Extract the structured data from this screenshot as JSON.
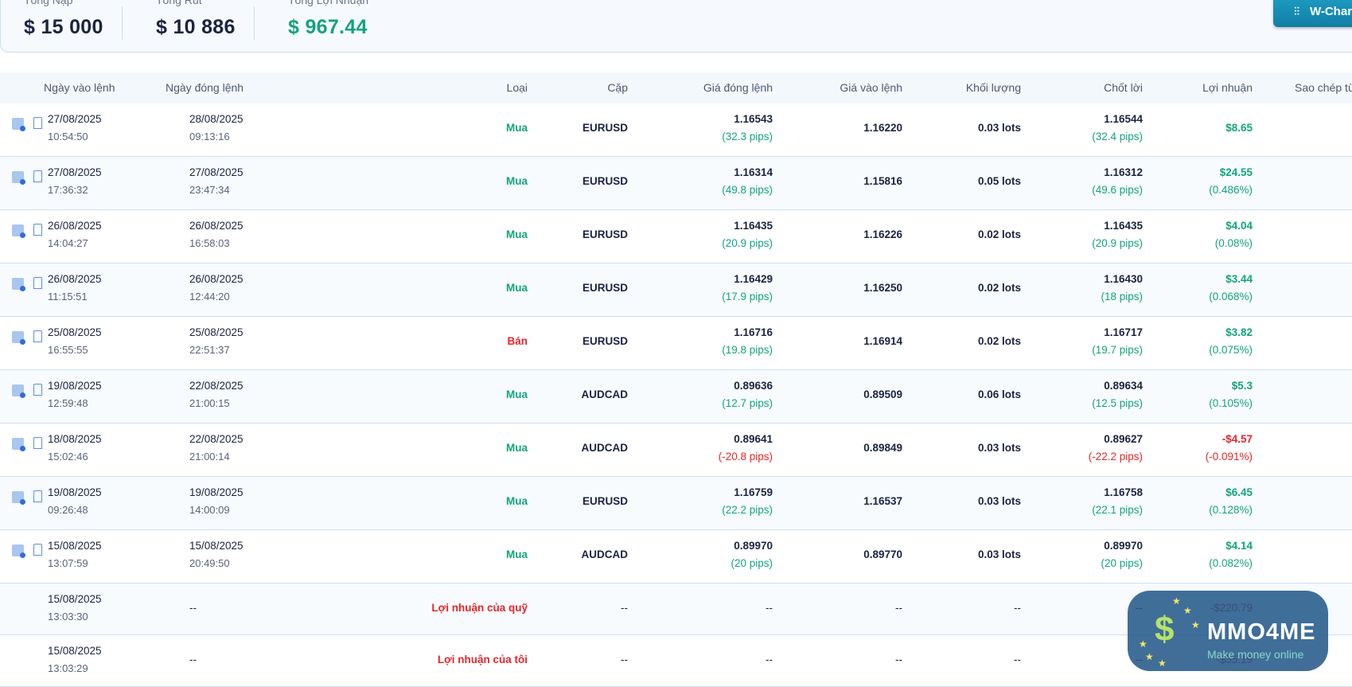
{
  "summary": {
    "deposit_label": "Tổng Nạp",
    "deposit": "$ 15 000",
    "withdraw_label": "Tổng Rút",
    "withdraw": "$ 10 886",
    "profit_label": "Tổng Lợi Nhuận",
    "profit": "$ 967.44"
  },
  "wchart_button": "W-Chart",
  "columns": [
    "Ngày vào lệnh",
    "Ngày đóng lệnh",
    "Loại",
    "Cặp",
    "Giá đóng lệnh",
    "Giá vào lệnh",
    "Khối lượng",
    "Chốt lời",
    "Lợi nhuận",
    "Sao chép từ"
  ],
  "rows": [
    {
      "open_date": "27/08/2025",
      "open_time": "10:54:50",
      "close_date": "28/08/2025",
      "close_time": "09:13:16",
      "type": "Mua",
      "pair": "EURUSD",
      "close_price": "1.16543",
      "close_pips": "(32.3 pips)",
      "open_price": "1.16220",
      "volume": "0.03 lots",
      "tp": "1.16544",
      "tp_pips": "(32.4 pips)",
      "profit": "$8.65",
      "profit_pct": "",
      "neg": false
    },
    {
      "open_date": "27/08/2025",
      "open_time": "17:36:32",
      "close_date": "27/08/2025",
      "close_time": "23:47:34",
      "type": "Mua",
      "pair": "EURUSD",
      "close_price": "1.16314",
      "close_pips": "(49.8 pips)",
      "open_price": "1.15816",
      "volume": "0.05 lots",
      "tp": "1.16312",
      "tp_pips": "(49.6 pips)",
      "profit": "$24.55",
      "profit_pct": "(0.486%)",
      "neg": false
    },
    {
      "open_date": "26/08/2025",
      "open_time": "14:04:27",
      "close_date": "26/08/2025",
      "close_time": "16:58:03",
      "type": "Mua",
      "pair": "EURUSD",
      "close_price": "1.16435",
      "close_pips": "(20.9 pips)",
      "open_price": "1.16226",
      "volume": "0.02 lots",
      "tp": "1.16435",
      "tp_pips": "(20.9 pips)",
      "profit": "$4.04",
      "profit_pct": "(0.08%)",
      "neg": false
    },
    {
      "open_date": "26/08/2025",
      "open_time": "11:15:51",
      "close_date": "26/08/2025",
      "close_time": "12:44:20",
      "type": "Mua",
      "pair": "EURUSD",
      "close_price": "1.16429",
      "close_pips": "(17.9 pips)",
      "open_price": "1.16250",
      "volume": "0.02 lots",
      "tp": "1.16430",
      "tp_pips": "(18 pips)",
      "profit": "$3.44",
      "profit_pct": "(0.068%)",
      "neg": false
    },
    {
      "open_date": "25/08/2025",
      "open_time": "16:55:55",
      "close_date": "25/08/2025",
      "close_time": "22:51:37",
      "type": "Bán",
      "pair": "EURUSD",
      "close_price": "1.16716",
      "close_pips": "(19.8 pips)",
      "open_price": "1.16914",
      "volume": "0.02 lots",
      "tp": "1.16717",
      "tp_pips": "(19.7 pips)",
      "profit": "$3.82",
      "profit_pct": "(0.075%)",
      "neg": false
    },
    {
      "open_date": "19/08/2025",
      "open_time": "12:59:48",
      "close_date": "22/08/2025",
      "close_time": "21:00:15",
      "type": "Mua",
      "pair": "AUDCAD",
      "close_price": "0.89636",
      "close_pips": "(12.7 pips)",
      "open_price": "0.89509",
      "volume": "0.06 lots",
      "tp": "0.89634",
      "tp_pips": "(12.5 pips)",
      "profit": "$5.3",
      "profit_pct": "(0.105%)",
      "neg": false
    },
    {
      "open_date": "18/08/2025",
      "open_time": "15:02:46",
      "close_date": "22/08/2025",
      "close_time": "21:00:14",
      "type": "Mua",
      "pair": "AUDCAD",
      "close_price": "0.89641",
      "close_pips": "(-20.8 pips)",
      "open_price": "0.89849",
      "volume": "0.03 lots",
      "tp": "0.89627",
      "tp_pips": "(-22.2 pips)",
      "profit": "-$4.57",
      "profit_pct": "(-0.091%)",
      "neg": true
    },
    {
      "open_date": "19/08/2025",
      "open_time": "09:26:48",
      "close_date": "19/08/2025",
      "close_time": "14:00:09",
      "type": "Mua",
      "pair": "EURUSD",
      "close_price": "1.16759",
      "close_pips": "(22.2 pips)",
      "open_price": "1.16537",
      "volume": "0.03 lots",
      "tp": "1.16758",
      "tp_pips": "(22.1 pips)",
      "profit": "$6.45",
      "profit_pct": "(0.128%)",
      "neg": false
    },
    {
      "open_date": "15/08/2025",
      "open_time": "13:07:59",
      "close_date": "15/08/2025",
      "close_time": "20:49:50",
      "type": "Mua",
      "pair": "AUDCAD",
      "close_price": "0.89970",
      "close_pips": "(20 pips)",
      "open_price": "0.89770",
      "volume": "0.03 lots",
      "tp": "0.89970",
      "tp_pips": "(20 pips)",
      "profit": "$4.14",
      "profit_pct": "(0.082%)",
      "neg": false
    }
  ],
  "fund_rows": [
    {
      "open_date": "15/08/2025",
      "open_time": "13:03:30",
      "close_date": "--",
      "type": "Lợi nhuận của quỹ",
      "pair": "--",
      "close_price": "--",
      "open_price": "--",
      "volume": "--",
      "tp": "--",
      "profit": "-$220.79"
    },
    {
      "open_date": "15/08/2025",
      "open_time": "13:03:29",
      "close_date": "--",
      "type": "Lợi nhuận của tôi",
      "pair": "--",
      "close_price": "--",
      "open_price": "--",
      "volume": "--",
      "tp": "--",
      "profit": "-$55.19"
    }
  ],
  "logo": {
    "name": "MMO4ME",
    "tagline": "Make money online"
  },
  "colors": {
    "green": "#14a37c",
    "red": "#e5262b",
    "navy": "#1a2340"
  }
}
